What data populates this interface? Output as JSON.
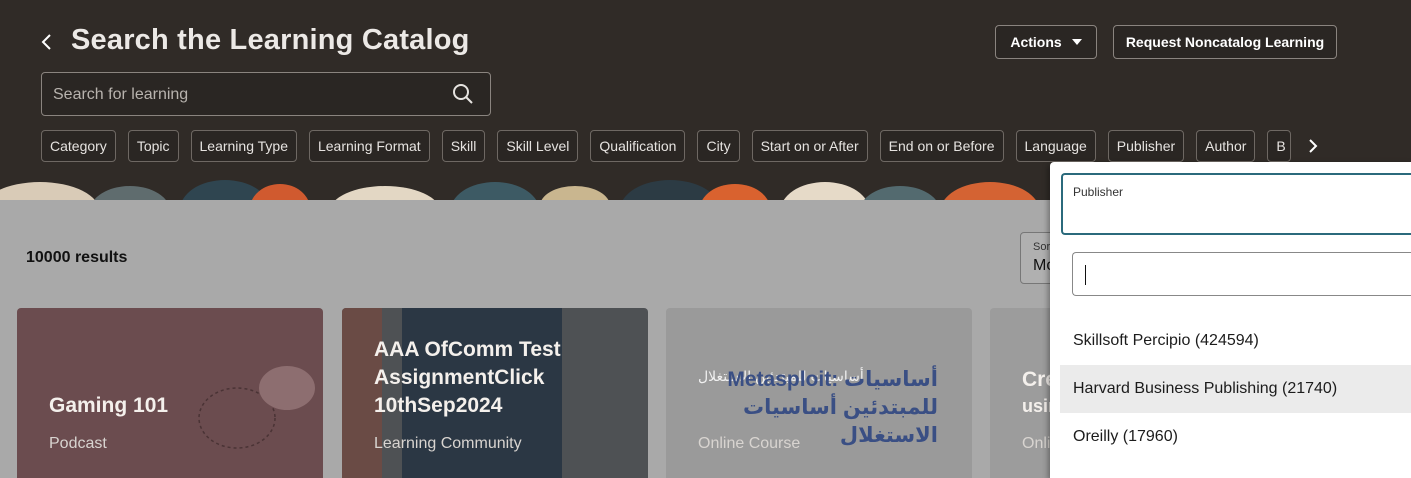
{
  "header": {
    "title": "Search the Learning Catalog",
    "actions_label": "Actions",
    "request_label": "Request Noncatalog Learning",
    "search_placeholder": "Search for learning"
  },
  "filters": [
    "Category",
    "Topic",
    "Learning Type",
    "Learning Format",
    "Skill",
    "Skill Level",
    "Qualification",
    "City",
    "Start on or After",
    "End on or Before",
    "Language",
    "Publisher",
    "Author",
    "B"
  ],
  "results": {
    "count_text": "10000 results",
    "sort_label": "Sort",
    "sort_value": "Most"
  },
  "cards": [
    {
      "title": "Gaming 101",
      "type": "Podcast"
    },
    {
      "title": "AAA OfComm Test AssignmentClick 10thSep2024",
      "type": "Learning Community"
    },
    {
      "title": "Metasploit: أساسيات للمبتدئين أساسيات الاستغلال",
      "overlay": "أساسيات للمبتدئين الاستغلال",
      "type": "Online Course"
    },
    {
      "title": "Crea",
      "title2": "usin",
      "type": "Onlin"
    }
  ],
  "publisher_dropdown": {
    "label": "Publisher",
    "options": [
      {
        "label": "Skillsoft Percipio (424594)",
        "highlighted": false
      },
      {
        "label": "Harvard Business Publishing (21740)",
        "highlighted": true
      },
      {
        "label": "Oreilly (17960)",
        "highlighted": false
      }
    ]
  },
  "colors": {
    "header_bg": "#302b27",
    "accent_border": "#2b6a7c",
    "overlay": "#a9a9a9"
  }
}
